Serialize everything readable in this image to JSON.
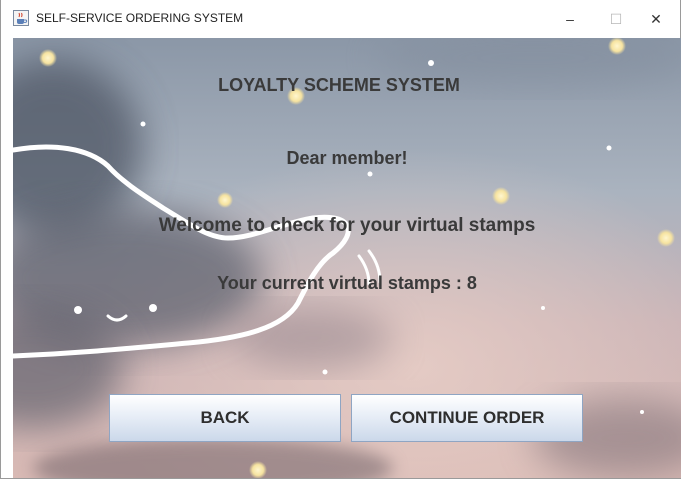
{
  "window": {
    "title": "SELF-SERVICE ORDERING SYSTEM",
    "app_icon": "java-cup-icon",
    "controls": {
      "minimize": "–",
      "maximize": "☐",
      "close": "✕"
    }
  },
  "main": {
    "heading": "LOYALTY SCHEME SYSTEM",
    "greeting": "Dear member!",
    "welcome": "Welcome to check for your virtual stamps",
    "stamps_text": "Your current virtual stamps : 8",
    "stamp_count": 8
  },
  "buttons": {
    "back_label": "BACK",
    "continue_label": "CONTINUE ORDER"
  },
  "colors": {
    "text": "#3a3a3a",
    "button_border": "#8fa5c3",
    "sky_top": "#8a97a8",
    "sky_bottom": "#d7b9b8"
  }
}
